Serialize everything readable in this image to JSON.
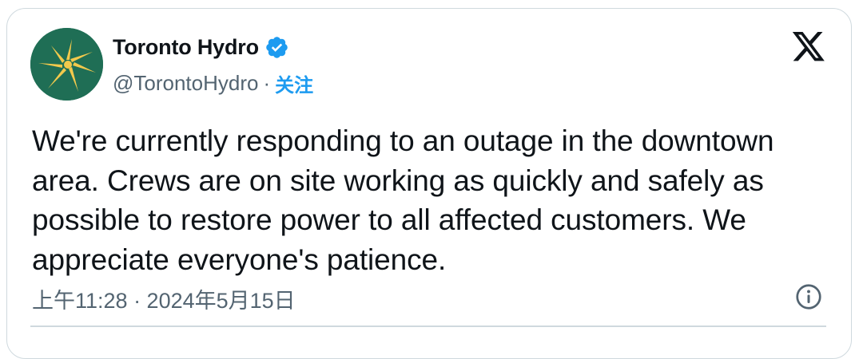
{
  "tweet": {
    "author": {
      "display_name": "Toronto Hydro",
      "handle": "@TorontoHydro",
      "separator": "·",
      "follow_label": "关注",
      "verified": true,
      "avatar_icon": "toronto-hydro-logo",
      "avatar_color": "#1f6e55"
    },
    "platform_icon": "x-logo-icon",
    "text_lines": [
      "We're currently responding to an outage in the downtown",
      "area. Crews are on site working as quickly and safely as",
      "possible to restore power to all affected customers. We",
      "appreciate everyone's patience."
    ],
    "timestamp": "上午11:28 · 2024年5月15日",
    "info_icon": "info-icon",
    "colors": {
      "accent": "#1d9bf0",
      "text": "#0f1419",
      "secondary": "#536471",
      "border": "#cfd9de"
    }
  }
}
